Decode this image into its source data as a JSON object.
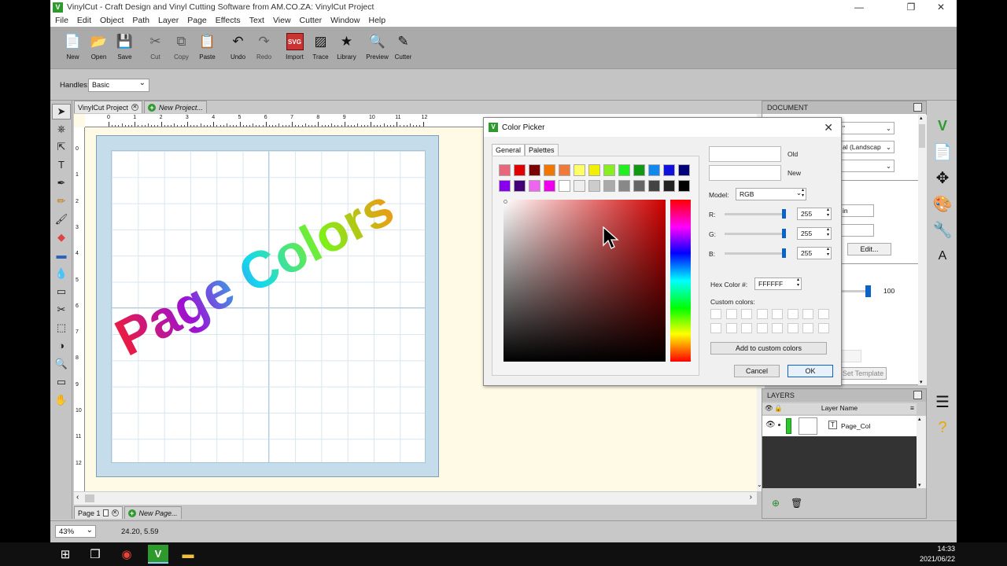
{
  "window": {
    "title": "VinylCut - Craft Design and Vinyl Cutting Software from AM.CO.ZA: VinylCut Project",
    "minimize": "—",
    "maximize": "❐",
    "close": "✕"
  },
  "menu": [
    "File",
    "Edit",
    "Object",
    "Path",
    "Layer",
    "Page",
    "Effects",
    "Text",
    "View",
    "Cutter",
    "Window",
    "Help"
  ],
  "toolbar": [
    {
      "label": "New",
      "icon": "📄",
      "name": "new-button"
    },
    {
      "label": "Open",
      "icon": "📂",
      "name": "open-button"
    },
    {
      "label": "Save",
      "icon": "💾",
      "name": "save-button"
    },
    {
      "label": "Cut",
      "icon": "✂",
      "name": "cut-button",
      "disabled": true
    },
    {
      "label": "Copy",
      "icon": "⧉",
      "name": "copy-button",
      "disabled": true
    },
    {
      "label": "Paste",
      "icon": "📋",
      "name": "paste-button"
    },
    {
      "label": "Undo",
      "icon": "↶",
      "name": "undo-button"
    },
    {
      "label": "Redo",
      "icon": "↷",
      "name": "redo-button",
      "disabled": true
    },
    {
      "label": "Import",
      "icon": "SVG",
      "name": "import-button"
    },
    {
      "label": "Trace",
      "icon": "▨",
      "name": "trace-button"
    },
    {
      "label": "Library",
      "icon": "★",
      "name": "library-button"
    },
    {
      "label": "Preview",
      "icon": "🔍",
      "name": "preview-button"
    },
    {
      "label": "Cutter",
      "icon": "✎",
      "name": "cutter-button"
    }
  ],
  "handles": {
    "label": "Handles:",
    "value": "Basic"
  },
  "tabs": {
    "project": "VinylCut Project",
    "new_project": "New Project..."
  },
  "page_tabs": {
    "page": "Page 1",
    "new_page": "New Page..."
  },
  "ruler": {
    "h": [
      "0",
      "1",
      "2",
      "3",
      "4",
      "5",
      "6",
      "7",
      "8",
      "9",
      "10",
      "11",
      "12"
    ],
    "v": [
      "0",
      "1",
      "2",
      "3",
      "4",
      "5",
      "6",
      "7",
      "8",
      "9",
      "10",
      "11",
      "12"
    ]
  },
  "artwork": {
    "text": "Page Colors"
  },
  "status": {
    "zoom": "43%",
    "coords": "24.20, 5.59"
  },
  "document_panel": {
    "title": "DOCUMENT",
    "orientation": "al (Landscap",
    "units": "in",
    "edit": "Edit...",
    "opacity": "100",
    "set_template": "Set Template"
  },
  "layers_panel": {
    "title": "LAYERS",
    "column": "Layer Name",
    "layer": "Page_Col"
  },
  "color_picker": {
    "title": "Color Picker",
    "tabs": [
      "General",
      "Palettes"
    ],
    "old_label": "Old",
    "new_label": "New",
    "model_label": "Model:",
    "model": "RGB",
    "channels": [
      {
        "label": "R:",
        "value": "255"
      },
      {
        "label": "G:",
        "value": "255"
      },
      {
        "label": "B:",
        "value": "255"
      }
    ],
    "hex_label": "Hex Color #:",
    "hex": "FFFFFF",
    "custom_label": "Custom colors:",
    "add_custom": "Add to custom colors",
    "cancel": "Cancel",
    "ok": "OK",
    "swatches": [
      "#e8677a",
      "#e00000",
      "#7a0000",
      "#f07800",
      "#f07a3a",
      "#ffff66",
      "#f0f000",
      "#88ee22",
      "#22ee22",
      "#119911",
      "#1188ee",
      "#1111dd",
      "#000077",
      "#8800ee",
      "#440077",
      "#ee66ee",
      "#ee00ee",
      "#ffffff",
      "#eeeeee",
      "#cccccc",
      "#aaaaaa",
      "#888888",
      "#666666",
      "#444444",
      "#222222",
      "#000000"
    ]
  },
  "taskbar": {
    "time": "14:33",
    "date": "2021/06/22"
  }
}
